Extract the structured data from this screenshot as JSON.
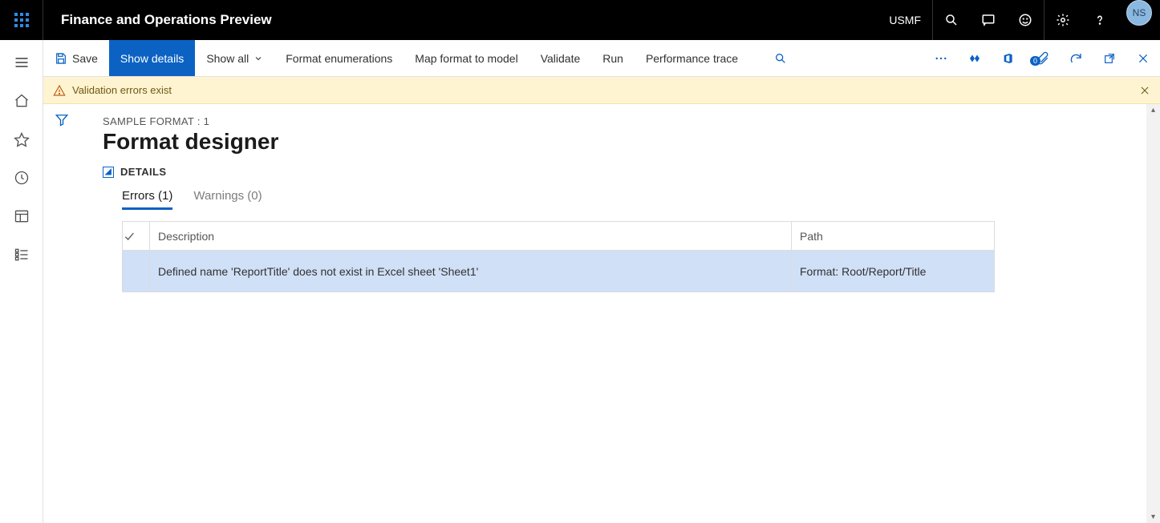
{
  "header": {
    "app_title": "Finance and Operations Preview",
    "company": "USMF",
    "avatar_initials": "NS"
  },
  "actionbar": {
    "save": "Save",
    "show_details": "Show details",
    "show_all": "Show all",
    "format_enums": "Format enumerations",
    "map_format": "Map format to model",
    "validate": "Validate",
    "run": "Run",
    "perf_trace": "Performance trace",
    "doc_badge": "0"
  },
  "banner": {
    "message": "Validation errors exist"
  },
  "page": {
    "breadcrumb": "SAMPLE FORMAT : 1",
    "title": "Format designer",
    "details_label": "DETAILS"
  },
  "tabs": {
    "errors": "Errors (1)",
    "warnings": "Warnings (0)"
  },
  "grid": {
    "col_description": "Description",
    "col_path": "Path",
    "rows": [
      {
        "description": "Defined name 'ReportTitle' does not exist in Excel sheet 'Sheet1'",
        "path": "Format: Root/Report/Title"
      }
    ]
  }
}
